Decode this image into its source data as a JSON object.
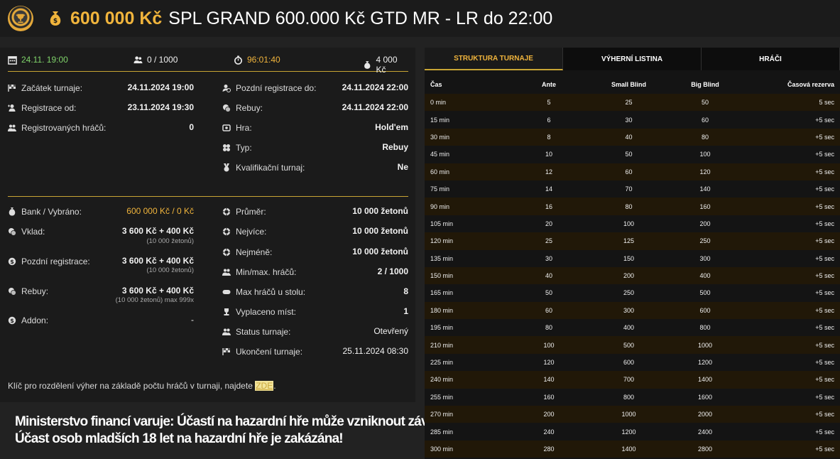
{
  "header": {
    "amount": "600 000 Kč",
    "title": "SPL GRAND 600.000 Kč GTD MR - LR do 22:00"
  },
  "stats": {
    "date": "24.11. 19:00",
    "players": "0 / 1000",
    "countdown": "96:01:40",
    "buyin": "4 000 Kč"
  },
  "info_left": [
    {
      "label": "Začátek turnaje:",
      "value": "24.11.2024 19:00",
      "icon": "flag-icon"
    },
    {
      "label": "Registrace od:",
      "value": "23.11.2024 19:30",
      "icon": "user-add-icon"
    },
    {
      "label": "Registrovaných hráčů:",
      "value": "0",
      "icon": "users-icon"
    }
  ],
  "info_right": [
    {
      "label": "Pozdní registrace do:",
      "value": "24.11.2024 22:00",
      "icon": "user-clock-icon"
    },
    {
      "label": "Rebuy:",
      "value": "24.11.2024 22:00",
      "icon": "coins-icon"
    },
    {
      "label": "Hra:",
      "value": "Hold'em",
      "icon": "cards-icon"
    },
    {
      "label": "Typ:",
      "value": "Rebuy",
      "icon": "clubs-icon"
    },
    {
      "label": "Kvalifikační turnaj:",
      "value": "Ne",
      "icon": "medal-icon"
    }
  ],
  "money_left": [
    {
      "label": "Bank / Vybráno:",
      "value": "600 000 Kč / 0 Kč",
      "icon": "moneybag-icon"
    },
    {
      "label": "Vklad:",
      "value": "3 600 Kč + 400 Kč",
      "sub": "(10 000 žetonů)",
      "icon": "coins-icon"
    },
    {
      "label": "Pozdní registrace:",
      "value": "3 600 Kč + 400 Kč",
      "sub": "(10 000 žetonů)",
      "icon": "dollar-coin-icon"
    },
    {
      "label": "Rebuy:",
      "value": "3 600 Kč + 400 Kč",
      "sub": "(10 000 žetonů) max 999x",
      "icon": "coins-icon"
    },
    {
      "label": "Addon:",
      "value": "-",
      "icon": "dollar-coin-icon"
    }
  ],
  "money_right": [
    {
      "label": "Průměr:",
      "value": "10 000 žetonů",
      "icon": "chip-icon"
    },
    {
      "label": "Nejvíce:",
      "value": "10 000 žetonů",
      "icon": "chip-icon"
    },
    {
      "label": "Nejméně:",
      "value": "10 000 žetonů",
      "icon": "chip-icon"
    },
    {
      "label": "Min/max. hráčů:",
      "value": "2 / 1000",
      "icon": "users-icon"
    },
    {
      "label": "Max hráčů u stolu:",
      "value": "8",
      "icon": "table-icon"
    },
    {
      "label": "Vyplaceno míst:",
      "value": "1",
      "icon": "trophy-icon"
    },
    {
      "label": "Status turnaje:",
      "value": "Otevřený",
      "icon": "users-icon"
    },
    {
      "label": "Ukončení turnaje:",
      "value": "25.11.2024 08:30",
      "icon": "finish-flag-icon"
    }
  ],
  "note": {
    "text": "Klíč pro rozdělení výher na základě počtu hráčů v turnaji, najdete",
    "link": "ZDE",
    "suffix": "."
  },
  "warning": {
    "line1": "Ministerstvo financí varuje: Účastí na hazardní hře může vzniknout závislost!",
    "line2": "Účast osob mladších 18 let na hazardní hře je zakázána!"
  },
  "tabs": [
    "STRUKTURA TURNAJE",
    "VÝHERNÍ LISTINA",
    "HRÁČI"
  ],
  "structure": {
    "headers": [
      "Čas",
      "Ante",
      "Small Blind",
      "Big Blind",
      "Časová rezerva"
    ],
    "rows": [
      [
        "0 min",
        "5",
        "25",
        "50",
        "5 sec"
      ],
      [
        "15 min",
        "6",
        "30",
        "60",
        "+5 sec"
      ],
      [
        "30 min",
        "8",
        "40",
        "80",
        "+5 sec"
      ],
      [
        "45 min",
        "10",
        "50",
        "100",
        "+5 sec"
      ],
      [
        "60 min",
        "12",
        "60",
        "120",
        "+5 sec"
      ],
      [
        "75 min",
        "14",
        "70",
        "140",
        "+5 sec"
      ],
      [
        "90 min",
        "16",
        "80",
        "160",
        "+5 sec"
      ],
      [
        "105 min",
        "20",
        "100",
        "200",
        "+5 sec"
      ],
      [
        "120 min",
        "25",
        "125",
        "250",
        "+5 sec"
      ],
      [
        "135 min",
        "30",
        "150",
        "300",
        "+5 sec"
      ],
      [
        "150 min",
        "40",
        "200",
        "400",
        "+5 sec"
      ],
      [
        "165 min",
        "50",
        "250",
        "500",
        "+5 sec"
      ],
      [
        "180 min",
        "60",
        "300",
        "600",
        "+5 sec"
      ],
      [
        "195 min",
        "80",
        "400",
        "800",
        "+5 sec"
      ],
      [
        "210 min",
        "100",
        "500",
        "1000",
        "+5 sec"
      ],
      [
        "225 min",
        "120",
        "600",
        "1200",
        "+5 sec"
      ],
      [
        "240 min",
        "140",
        "700",
        "1400",
        "+5 sec"
      ],
      [
        "255 min",
        "160",
        "800",
        "1600",
        "+5 sec"
      ],
      [
        "270 min",
        "200",
        "1000",
        "2000",
        "+5 sec"
      ],
      [
        "285 min",
        "240",
        "1200",
        "2400",
        "+5 sec"
      ],
      [
        "300 min",
        "280",
        "1400",
        "2800",
        "+5 sec"
      ]
    ]
  }
}
